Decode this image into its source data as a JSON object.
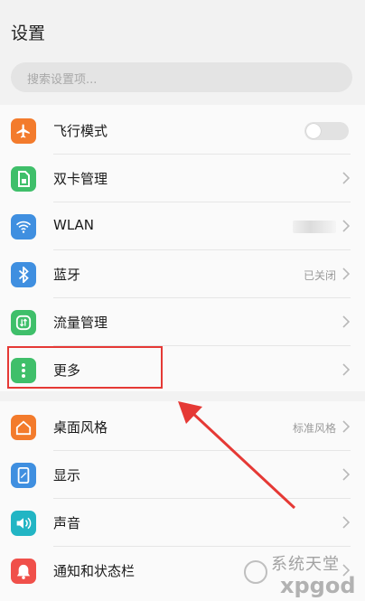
{
  "header": {
    "title": "设置",
    "search_placeholder": "搜索设置项..."
  },
  "groups": [
    {
      "items": [
        {
          "label": "飞行模式",
          "icon": "airplane-icon",
          "color": "#f37b2c",
          "control": "toggle",
          "toggle_on": false
        },
        {
          "label": "双卡管理",
          "icon": "sim-card-icon",
          "color": "#3fbf6a",
          "control": "chevron"
        },
        {
          "label": "WLAN",
          "icon": "wifi-icon",
          "color": "#3f8fe0",
          "control": "chevron",
          "value_blurred": true
        },
        {
          "label": "蓝牙",
          "icon": "bluetooth-icon",
          "color": "#3f8fe0",
          "control": "chevron",
          "value": "已关闭"
        },
        {
          "label": "流量管理",
          "icon": "data-usage-icon",
          "color": "#3fbf6a",
          "control": "chevron"
        },
        {
          "label": "更多",
          "icon": "more-vertical-icon",
          "color": "#3fbf6a",
          "control": "chevron",
          "highlighted": true
        }
      ]
    },
    {
      "items": [
        {
          "label": "桌面风格",
          "icon": "home-style-icon",
          "color": "#f37b2c",
          "control": "chevron",
          "value": "标准风格"
        },
        {
          "label": "显示",
          "icon": "display-icon",
          "color": "#3f8fe0",
          "control": "chevron"
        },
        {
          "label": "声音",
          "icon": "sound-icon",
          "color": "#22b5c4",
          "control": "chevron"
        },
        {
          "label": "通知和状态栏",
          "icon": "notification-icon",
          "color": "#f0504a",
          "control": "chevron"
        }
      ]
    }
  ],
  "annotation": {
    "highlight_color": "#e53935",
    "arrow_color": "#e53935"
  },
  "watermark": {
    "text": "系统天堂",
    "sub": "xpgod"
  }
}
